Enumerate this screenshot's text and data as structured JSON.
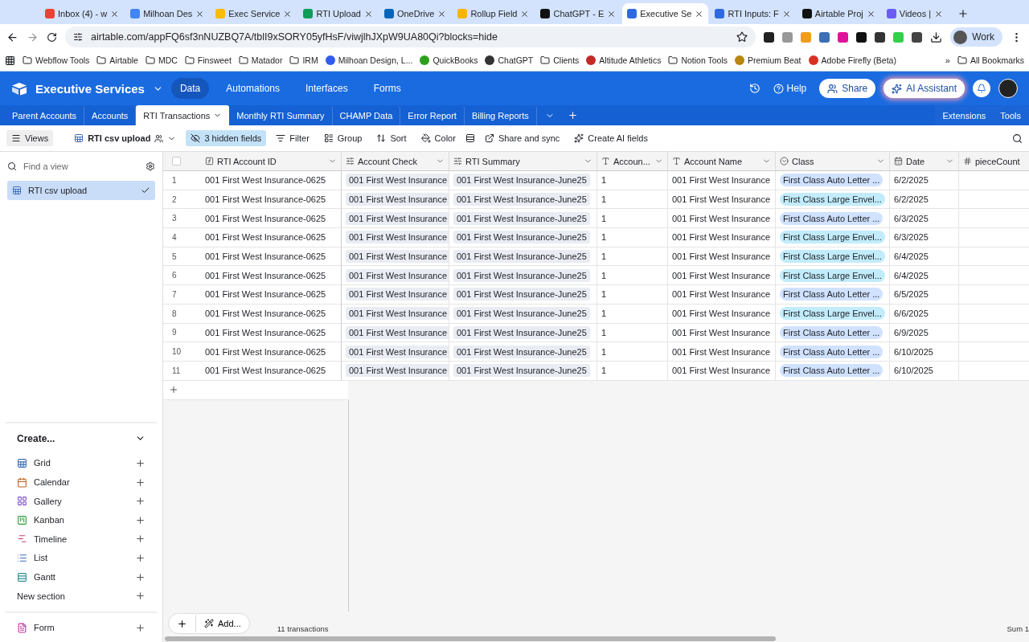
{
  "browser": {
    "tabs": [
      {
        "title": "Inbox (4) - w",
        "selected": false
      },
      {
        "title": "Milhoan Des",
        "selected": false
      },
      {
        "title": "Exec Service",
        "selected": false
      },
      {
        "title": "RTI Upload",
        "selected": false
      },
      {
        "title": "OneDrive",
        "selected": false
      },
      {
        "title": "Rollup Field",
        "selected": false
      },
      {
        "title": "ChatGPT - E",
        "selected": false
      },
      {
        "title": "Executive Se",
        "selected": true
      },
      {
        "title": "RTI Inputs: F",
        "selected": false
      },
      {
        "title": "Airtable Proj",
        "selected": false
      },
      {
        "title": "Videos |",
        "selected": false
      }
    ],
    "url": "airtable.com/appFQ6sf3nNUZBQ7A/tblI9xSORY05yfHsF/viwjlhJXpW9UA80Qi?blocks=hide",
    "profile": "Work",
    "bookmarks": [
      {
        "label": "Webflow Tools",
        "kind": "folder"
      },
      {
        "label": "Airtable",
        "kind": "folder"
      },
      {
        "label": "MDC",
        "kind": "folder"
      },
      {
        "label": "Finsweet",
        "kind": "folder"
      },
      {
        "label": "Matador",
        "kind": "folder"
      },
      {
        "label": "IRM",
        "kind": "folder"
      },
      {
        "label": "Milhoan Design, L...",
        "kind": "site"
      },
      {
        "label": "QuickBooks",
        "kind": "site"
      },
      {
        "label": "ChatGPT",
        "kind": "site"
      },
      {
        "label": "Clients",
        "kind": "folder"
      },
      {
        "label": "Altitude Athletics",
        "kind": "site"
      },
      {
        "label": "Notion Tools",
        "kind": "folder"
      },
      {
        "label": "Premium Beat",
        "kind": "site"
      },
      {
        "label": "Adobe Firefly (Beta)",
        "kind": "site"
      }
    ],
    "bookmarks_overflow": "»",
    "all_bookmarks": "All Bookmarks"
  },
  "app": {
    "base_name": "Executive Services",
    "nav": [
      {
        "label": "Data",
        "selected": true
      },
      {
        "label": "Automations",
        "selected": false
      },
      {
        "label": "Interfaces",
        "selected": false
      },
      {
        "label": "Forms",
        "selected": false
      }
    ],
    "help": "Help",
    "share": "Share",
    "ai_assistant": "AI Assistant"
  },
  "tables": [
    {
      "label": "Parent Accounts",
      "selected": false
    },
    {
      "label": "Accounts",
      "selected": false
    },
    {
      "label": "RTI Transactions",
      "selected": true
    },
    {
      "label": "Monthly RTI Summary",
      "selected": false
    },
    {
      "label": "CHAMP Data",
      "selected": false
    },
    {
      "label": "Error Report",
      "selected": false
    },
    {
      "label": "Billing Reports",
      "selected": false
    }
  ],
  "extensions": "Extensions",
  "tools": "Tools",
  "toolbar": {
    "views": "Views",
    "view_name": "RTI csv upload",
    "hidden_fields": "3 hidden fields",
    "actions": [
      "Filter",
      "Group",
      "Sort",
      "Color",
      "Share and sync",
      "Create AI fields"
    ]
  },
  "sidebar": {
    "search_placeholder": "Find a view",
    "views": [
      {
        "label": "RTI csv upload",
        "selected": true
      }
    ],
    "create_title": "Create...",
    "create_items": [
      {
        "label": "Grid",
        "kind": "grid"
      },
      {
        "label": "Calendar",
        "kind": "calendar"
      },
      {
        "label": "Gallery",
        "kind": "gallery"
      },
      {
        "label": "Kanban",
        "kind": "kanban"
      },
      {
        "label": "Timeline",
        "kind": "timeline"
      },
      {
        "label": "List",
        "kind": "list"
      },
      {
        "label": "Gantt",
        "kind": "gantt"
      },
      {
        "label": "New section",
        "kind": "section"
      }
    ],
    "form_item": {
      "label": "Form",
      "kind": "form"
    }
  },
  "grid": {
    "select_all": {
      "checked": false
    },
    "columns": [
      {
        "label": "RTI Account ID",
        "kind": "formula"
      },
      {
        "label": "Account Check",
        "kind": "lookup"
      },
      {
        "label": "RTI Summary",
        "kind": "lookup"
      },
      {
        "label": "Accoun...",
        "kind": "text"
      },
      {
        "label": "Account Name",
        "kind": "text"
      },
      {
        "label": "Class",
        "kind": "select"
      },
      {
        "label": "Date",
        "kind": "date"
      },
      {
        "label": "pieceCount",
        "kind": "number"
      }
    ],
    "rows": [
      {
        "number": "1",
        "cells": [
          "001 First West Insurance-0625",
          "001 First West Insurance",
          "001 First West Insurance-June25",
          "1",
          "001 First West Insurance",
          "First Class Auto Letter ...",
          "6/2/2025",
          ""
        ],
        "color": "#d0e2ff"
      },
      {
        "number": "2",
        "cells": [
          "001 First West Insurance-0625",
          "001 First West Insurance",
          "001 First West Insurance-June25",
          "1",
          "001 First West Insurance",
          "First Class Large Envel...",
          "6/2/2025",
          ""
        ],
        "color": "#c2ecfb"
      },
      {
        "number": "3",
        "cells": [
          "001 First West Insurance-0625",
          "001 First West Insurance",
          "001 First West Insurance-June25",
          "1",
          "001 First West Insurance",
          "First Class Auto Letter ...",
          "6/3/2025",
          ""
        ],
        "color": "#d0e2ff"
      },
      {
        "number": "4",
        "cells": [
          "001 First West Insurance-0625",
          "001 First West Insurance",
          "001 First West Insurance-June25",
          "1",
          "001 First West Insurance",
          "First Class Large Envel...",
          "6/3/2025",
          ""
        ],
        "color": "#c2ecfb"
      },
      {
        "number": "5",
        "cells": [
          "001 First West Insurance-0625",
          "001 First West Insurance",
          "001 First West Insurance-June25",
          "1",
          "001 First West Insurance",
          "First Class Large Envel...",
          "6/4/2025",
          ""
        ],
        "color": "#c2ecfb"
      },
      {
        "number": "6",
        "cells": [
          "001 First West Insurance-0625",
          "001 First West Insurance",
          "001 First West Insurance-June25",
          "1",
          "001 First West Insurance",
          "First Class Large Envel...",
          "6/4/2025",
          ""
        ],
        "color": "#c2ecfb"
      },
      {
        "number": "7",
        "cells": [
          "001 First West Insurance-0625",
          "001 First West Insurance",
          "001 First West Insurance-June25",
          "1",
          "001 First West Insurance",
          "First Class Auto Letter ...",
          "6/5/2025",
          ""
        ],
        "color": "#d0e2ff"
      },
      {
        "number": "8",
        "cells": [
          "001 First West Insurance-0625",
          "001 First West Insurance",
          "001 First West Insurance-June25",
          "1",
          "001 First West Insurance",
          "First Class Large Envel...",
          "6/6/2025",
          ""
        ],
        "color": "#c2ecfb"
      },
      {
        "number": "9",
        "cells": [
          "001 First West Insurance-0625",
          "001 First West Insurance",
          "001 First West Insurance-June25",
          "1",
          "001 First West Insurance",
          "First Class Auto Letter ...",
          "6/9/2025",
          ""
        ],
        "color": "#d0e2ff"
      },
      {
        "number": "10",
        "cells": [
          "001 First West Insurance-0625",
          "001 First West Insurance",
          "001 First West Insurance-June25",
          "1",
          "001 First West Insurance",
          "First Class Auto Letter ...",
          "6/10/2025",
          ""
        ],
        "color": "#d0e2ff"
      },
      {
        "number": "11",
        "cells": [
          "001 First West Insurance-0625",
          "001 First West Insurance",
          "001 First West Insurance-June25",
          "1",
          "001 First West Insurance",
          "First Class Auto Letter ...",
          "6/10/2025",
          ""
        ],
        "color": "#d0e2ff"
      }
    ],
    "add_label": "Add...",
    "record_count": "11 transactions",
    "summary": "Sum 1"
  }
}
